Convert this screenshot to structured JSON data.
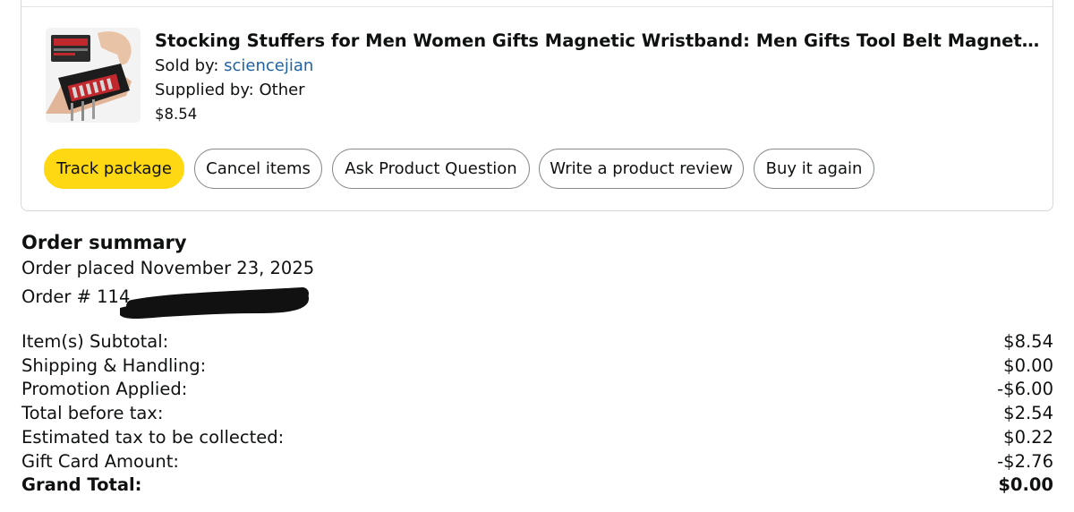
{
  "item": {
    "title": "Stocking Stuffers for Men Women Gifts Magnetic Wristband: Men Gifts Tool Belt Magnet Wrist...",
    "sold_by_label": "Sold by: ",
    "seller": "sciencejian",
    "supplied_by": "Supplied by: Other",
    "price": "$8.54",
    "image_icon": "product-thumbnail"
  },
  "actions": {
    "track": "Track package",
    "cancel": "Cancel items",
    "ask": "Ask Product Question",
    "review": "Write a product review",
    "buy_again": "Buy it again"
  },
  "summary": {
    "heading": "Order summary",
    "placed": "Order placed November 23, 2025",
    "order_number": "Order # 114",
    "rows": [
      {
        "label": "Item(s) Subtotal:",
        "value": "$8.54"
      },
      {
        "label": "Shipping & Handling:",
        "value": "$0.00"
      },
      {
        "label": "Promotion Applied:",
        "value": "-$6.00"
      },
      {
        "label": "Total before tax:",
        "value": "$2.54"
      },
      {
        "label": "Estimated tax to be collected:",
        "value": "$0.22"
      },
      {
        "label": "Gift Card Amount:",
        "value": "-$2.76"
      }
    ],
    "grand_label": "Grand Total:",
    "grand_value": "$0.00"
  },
  "colors": {
    "primary_button": "#ffd814",
    "link": "#2162a1",
    "border": "#d5d9d9"
  }
}
